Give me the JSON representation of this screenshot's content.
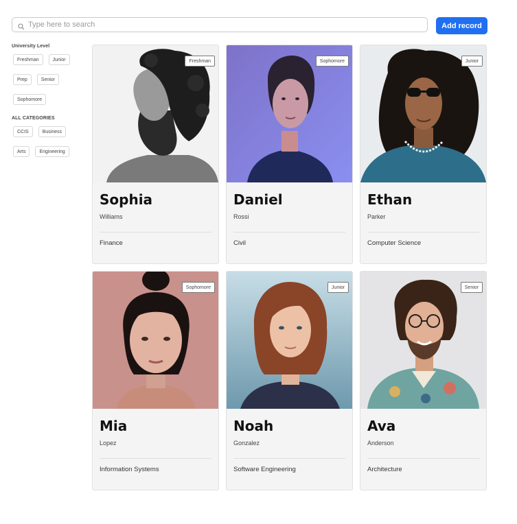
{
  "search": {
    "placeholder": "Type here to search",
    "value": ""
  },
  "toolbar": {
    "add_label": "Add record",
    "accent": "#1f6ff0"
  },
  "sidebar": {
    "level_heading": "University Level",
    "levels": [
      "Freshman",
      "Junior",
      "Prep",
      "Senior",
      "Sophomore"
    ],
    "category_heading": "ALL CATEGORIES",
    "categories": [
      "CCIS",
      "Business",
      "Arts",
      "Engineering"
    ]
  },
  "cards": [
    {
      "first": "Sophia",
      "last": "Williams",
      "major": "Finance",
      "level": "Freshman",
      "photo": "bearded-man-grayscale-portrait"
    },
    {
      "first": "Daniel",
      "last": "Rossi",
      "major": "Civil",
      "level": "Sophomore",
      "photo": "woman-blue-light-portrait"
    },
    {
      "first": "Ethan",
      "last": "Parker",
      "major": "Computer Science",
      "level": "Junior",
      "photo": "curly-hair-sunglasses-portrait"
    },
    {
      "first": "Mia",
      "last": "Lopez",
      "major": "Information Systems",
      "level": "Sophomore",
      "photo": "woman-pink-background-portrait"
    },
    {
      "first": "Noah",
      "last": "Gonzalez",
      "major": "Software Engineering",
      "level": "Junior",
      "photo": "red-hair-woman-portrait"
    },
    {
      "first": "Ava",
      "last": "Anderson",
      "major": "Architecture",
      "level": "Senior",
      "photo": "curly-hair-glasses-man-portrait"
    }
  ]
}
